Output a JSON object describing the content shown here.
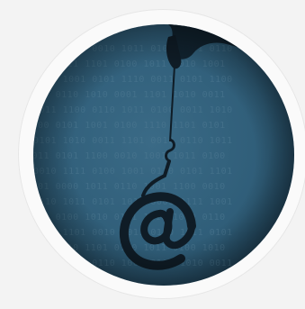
{
  "image": {
    "subject": "phishing-hook-icon",
    "colors": {
      "page_background": "#f3f3f3",
      "ring": "#fafafa",
      "ring_border": "#e6e6e6",
      "circle_background": "#2f5d78",
      "circle_shadow": "#1d3d52",
      "binary_text": "#4f7a93",
      "hand": "#10202b",
      "hook": "#0f1c26"
    },
    "binary_rows": [
      "0101 1100 0010 1011 0100 1101 0110",
      "1010 0011 1101 0100 1011 0010 1001",
      "0110 1001 0101 1110 0011 0101 1100",
      "1001 0110 1010 0001 1101 1010 0011",
      "0011 1100 0110 1011 0100 0011 1010",
      "1100 0101 1001 0100 1110 1101 0101",
      "0101 1010 0011 1101 0010 0110 1011",
      "1011 0101 1100 0010 1001 1011 0100",
      "0010 1111 0100 1001 0110 0101 1101",
      "1101 0000 1011 0110 1001 1100 0010",
      "0110 1011 0101 1010 0001 0111 1001",
      "1001 0100 1010 0101 1110 1000 0110",
      "0101 1101 0010 1011 0100 1011 0101",
      "1010 0010 1101 0100 1011 0100 1010",
      "0011 1001 0110 1001 0101 1010 0011"
    ]
  }
}
